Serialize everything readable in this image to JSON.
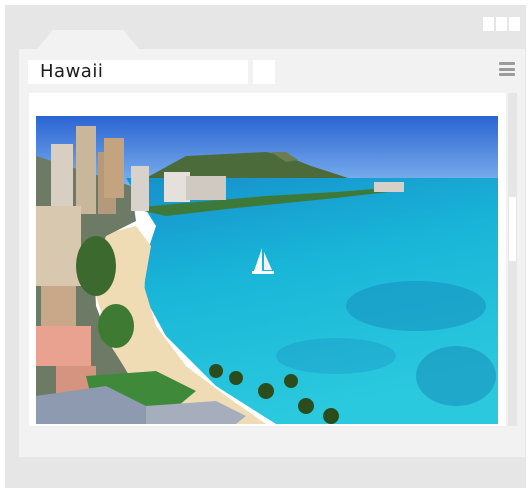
{
  "window": {
    "title": "Hawaii"
  },
  "icons": {
    "menu": "hamburger-menu-icon"
  },
  "image": {
    "subject": "beach-aerial-photo"
  },
  "colors": {
    "frame": "#e6e6e6",
    "panel": "#f2f2f2",
    "ocean": "#1fb4d6",
    "sky": "#2b6fd6"
  }
}
